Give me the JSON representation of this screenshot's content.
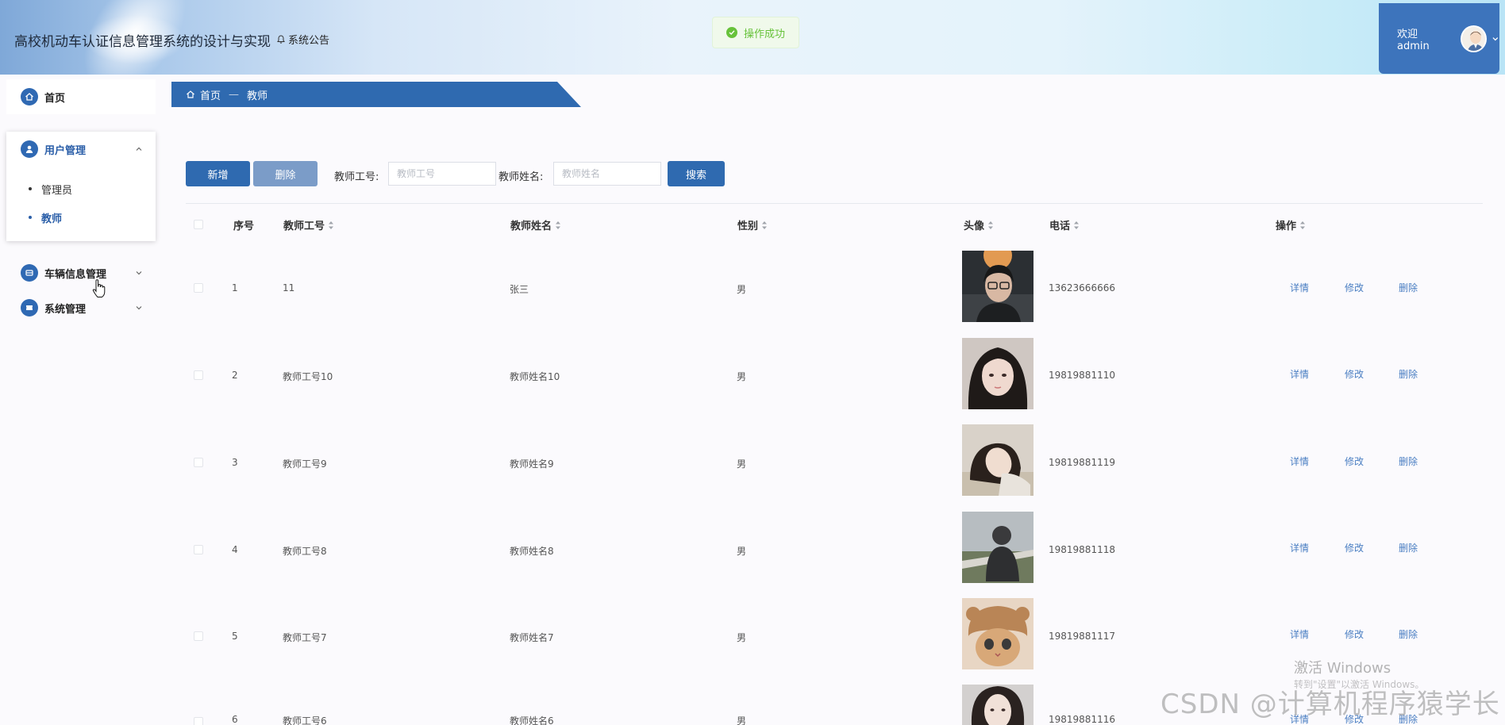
{
  "header": {
    "title": "高校机动车认证信息管理系统的设计与实现",
    "notice_label": "系统公告",
    "welcome": "欢迎 admin"
  },
  "toast": {
    "message": "操作成功",
    "type": "success"
  },
  "sidebar": {
    "home": "首页",
    "user_group": "用户管理",
    "sub_items": [
      "管理员",
      "教师"
    ],
    "vehicle_group": "车辆信息管理",
    "system_group": "系统管理"
  },
  "breadcrumb": {
    "home": "首页",
    "sep": "—",
    "current": "教师"
  },
  "toolbar": {
    "add": "新增",
    "delete": "删除",
    "id_label": "教师工号:",
    "id_placeholder": "教师工号",
    "name_label": "教师姓名:",
    "name_placeholder": "教师姓名",
    "search": "搜索"
  },
  "table": {
    "headers": [
      "序号",
      "教师工号",
      "教师姓名",
      "性别",
      "头像",
      "电话",
      "操作"
    ],
    "rows": [
      {
        "idx": "1",
        "id": "11",
        "name": "张三",
        "gender": "男",
        "phone": "13623666666"
      },
      {
        "idx": "2",
        "id": "教师工号10",
        "name": "教师姓名10",
        "gender": "男",
        "phone": "19819881110"
      },
      {
        "idx": "3",
        "id": "教师工号9",
        "name": "教师姓名9",
        "gender": "男",
        "phone": "19819881119"
      },
      {
        "idx": "4",
        "id": "教师工号8",
        "name": "教师姓名8",
        "gender": "男",
        "phone": "19819881118"
      },
      {
        "idx": "5",
        "id": "教师工号7",
        "name": "教师姓名7",
        "gender": "男",
        "phone": "19819881117"
      },
      {
        "idx": "6",
        "id": "教师工号6",
        "name": "教师姓名6",
        "gender": "男",
        "phone": "19819881116"
      }
    ],
    "actions": [
      "详情",
      "修改",
      "删除"
    ]
  },
  "watermarks": {
    "windows_line1": "激活 Windows",
    "windows_line2": "转到\"设置\"以激活 Windows。",
    "csdn": "CSDN @计算机程序猿学长"
  },
  "colors": {
    "primary": "#2f6ab0",
    "success": "#67c23a",
    "link": "#4a7ec2"
  }
}
